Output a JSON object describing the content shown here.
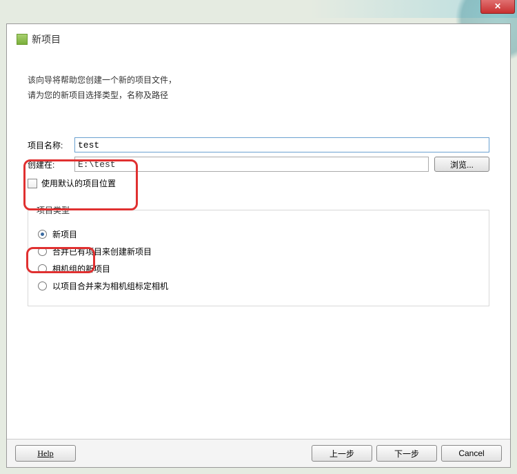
{
  "titlebar": {
    "close_glyph": "✕"
  },
  "header": {
    "title": "新项目"
  },
  "intro": {
    "line1": "该向导将帮助您创建一个新的项目文件，",
    "line2": "请为您的新项目选择类型，名称及路径"
  },
  "form": {
    "name_label": "项目名称:",
    "name_value": "test",
    "path_label": "创建在:",
    "path_value": "E:\\test",
    "browse_label": "浏览...",
    "default_location_label": "使用默认的项目位置"
  },
  "project_type": {
    "legend": "项目类型",
    "options": [
      "新项目",
      "合并已有项目来创建新项目",
      "相机组的新项目",
      "以项目合并来为相机组标定相机"
    ]
  },
  "buttons": {
    "help": "Help",
    "prev": "上一步",
    "next": "下一步",
    "cancel": "Cancel"
  }
}
